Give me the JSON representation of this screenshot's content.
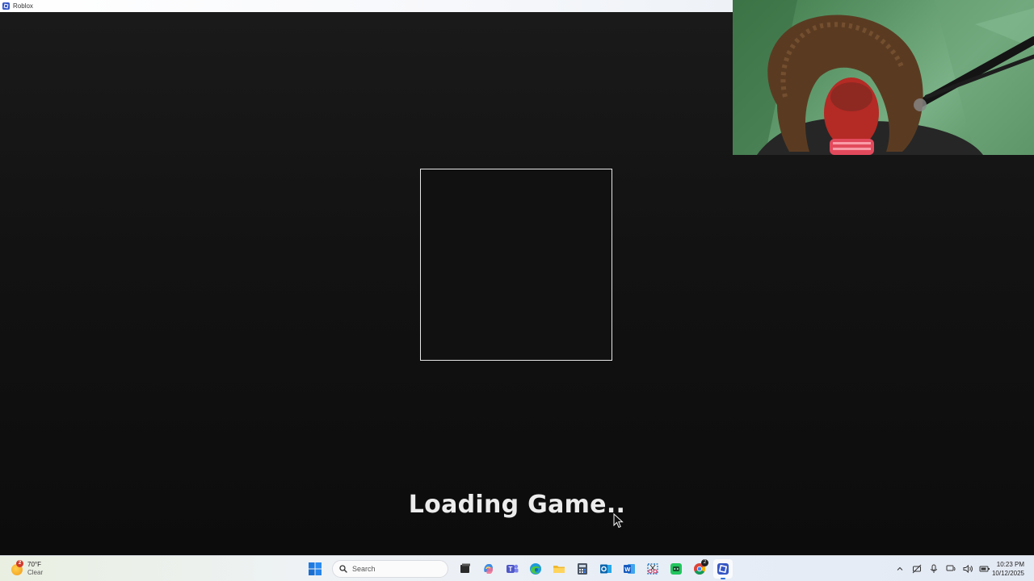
{
  "window": {
    "title": "Roblox"
  },
  "game": {
    "loading_text": "Loading Game.."
  },
  "taskbar": {
    "weather": {
      "badge": "2",
      "temperature": "70°F",
      "condition": "Clear"
    },
    "search": {
      "label": "Search"
    },
    "pinned_apps": [
      "windows-start-icon",
      "task-view-icon",
      "copilot-icon",
      "teams-icon",
      "edge-icon",
      "file-explorer-icon",
      "calculator-icon",
      "outlook-icon",
      "word-icon",
      "snipping-tool-icon",
      "app-green-icon",
      "chrome-icon",
      "roblox-icon"
    ],
    "chrome_badge": "2",
    "active_app": "roblox-icon",
    "tray_icons": [
      "chevron-up-icon",
      "network-off-icon",
      "microphone-icon",
      "wifi-icon",
      "speaker-icon",
      "battery-icon"
    ],
    "clock": {
      "time": "10:23 PM",
      "date": "10/12/2025"
    }
  },
  "colors": {
    "background": "#0e0e0e",
    "loading_text": "#ececec",
    "frame_border": "#e6e6e6",
    "taskbar_accent": "#2f6fd8"
  }
}
